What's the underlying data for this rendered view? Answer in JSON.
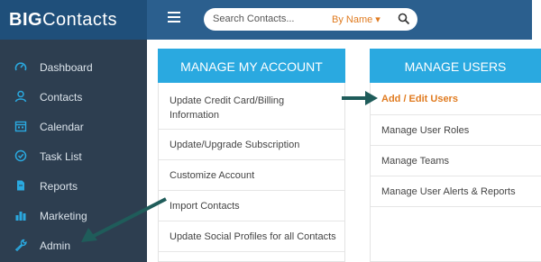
{
  "brand": {
    "name_bold": "BIG",
    "name_rest": "Contacts"
  },
  "search": {
    "placeholder": "Search Contacts...",
    "filter_label": "By Name ▾"
  },
  "sidebar": {
    "items": [
      {
        "label": "Dashboard",
        "icon": "gauge-icon"
      },
      {
        "label": "Contacts",
        "icon": "person-icon"
      },
      {
        "label": "Calendar",
        "icon": "calendar-icon"
      },
      {
        "label": "Task List",
        "icon": "check-circle-icon"
      },
      {
        "label": "Reports",
        "icon": "document-icon"
      },
      {
        "label": "Marketing",
        "icon": "bar-chart-icon"
      },
      {
        "label": "Admin",
        "icon": "wrench-icon"
      }
    ]
  },
  "account": {
    "title": "MANAGE MY ACCOUNT",
    "items": [
      "Update Credit Card/Billing Information",
      "Update/Upgrade Subscription",
      "Customize Account",
      "Import Contacts",
      "Update Social Profiles for all Contacts"
    ]
  },
  "users": {
    "title": "MANAGE USERS",
    "items": [
      "Add / Edit Users",
      "Manage User Roles",
      "Manage Teams",
      "Manage User Alerts & Reports"
    ]
  },
  "colors": {
    "accent": "#2aa9e0",
    "highlight": "#e07b20",
    "sidebar": "#2d3e50",
    "topbar": "#2b5f8e",
    "arrow": "#1f5c5a"
  }
}
